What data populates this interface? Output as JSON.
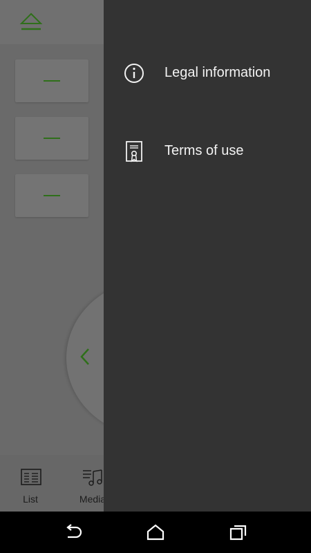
{
  "app": {
    "eject_icon": "eject-icon",
    "presets": [
      {
        "label": "—"
      },
      {
        "label": "—"
      },
      {
        "label": "—"
      }
    ],
    "dial_icon": "chevron-left-icon",
    "accent_color": "#2f6f1a",
    "bottom_nav": [
      {
        "label": "List",
        "icon": "list-icon"
      },
      {
        "label": "Media",
        "icon": "music-notes-icon"
      }
    ]
  },
  "drawer": {
    "items": [
      {
        "label": "Legal information",
        "icon": "info-icon"
      },
      {
        "label": "Terms of use",
        "icon": "certificate-document-icon"
      }
    ],
    "background": "#333333",
    "text_color": "#f2f2f2"
  },
  "system_nav": {
    "buttons": [
      "back-icon",
      "home-icon",
      "recent-apps-icon"
    ]
  }
}
